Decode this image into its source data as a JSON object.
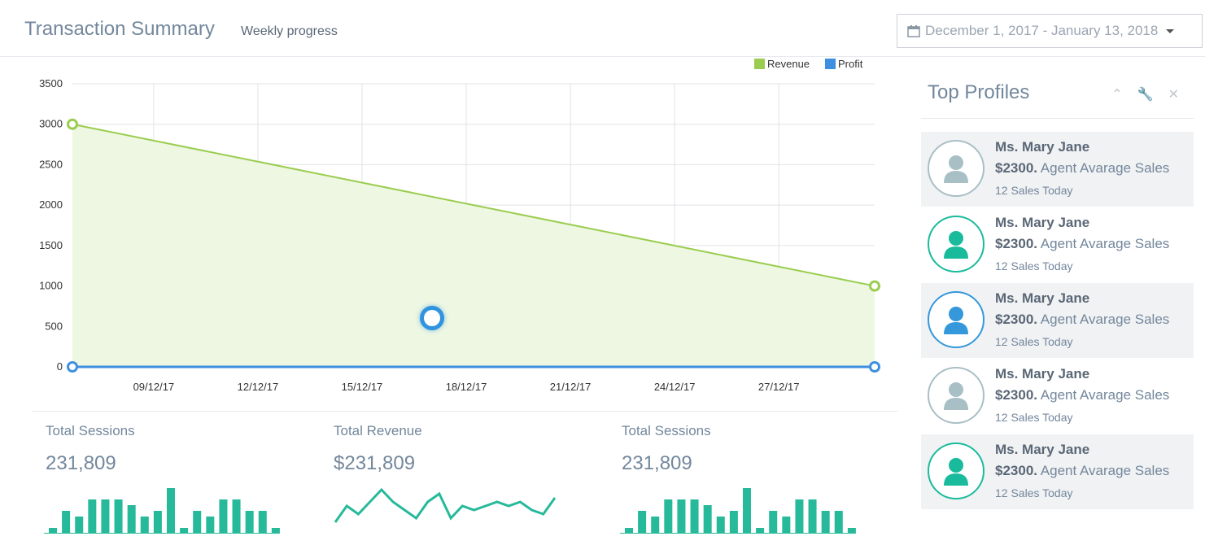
{
  "header": {
    "title": "Transaction Summary",
    "subtitle": "Weekly progress",
    "date_range": "December 1, 2017 - January 13, 2018"
  },
  "chart_data": {
    "type": "area",
    "x": [
      "09/12/17",
      "12/12/17",
      "15/12/17",
      "18/12/17",
      "21/12/17",
      "24/12/17",
      "27/12/17"
    ],
    "ylim": [
      0,
      3500
    ],
    "yticks": [
      0,
      500,
      1000,
      1500,
      2000,
      2500,
      3000,
      3500
    ],
    "grid": true,
    "legend_position": "top-right",
    "series": [
      {
        "name": "Revenue",
        "start": 3000,
        "end": 1000,
        "color": "#9acd4f"
      },
      {
        "name": "Profit",
        "start": 0,
        "end": 0,
        "color": "#3e8fe0"
      }
    ]
  },
  "stats": [
    {
      "label": "Total Sessions",
      "value": "231,809",
      "kind": "bars",
      "data": [
        1,
        4,
        3,
        6,
        6,
        6,
        5,
        3,
        4,
        8,
        1,
        4,
        3,
        6,
        6,
        4,
        4,
        1
      ]
    },
    {
      "label": "Total Revenue",
      "value": "$231,809",
      "kind": "line",
      "data": [
        2,
        6,
        4,
        7,
        10,
        7,
        5,
        3,
        7,
        9,
        3,
        6,
        5,
        6,
        7,
        6,
        7,
        5,
        4,
        8
      ]
    },
    {
      "label": "Total Sessions",
      "value": "231,809",
      "kind": "bars",
      "data": [
        1,
        4,
        3,
        6,
        6,
        6,
        5,
        3,
        4,
        8,
        1,
        4,
        3,
        6,
        6,
        4,
        4,
        1
      ]
    }
  ],
  "profiles": {
    "title": "Top Profiles",
    "items": [
      {
        "name": "Ms. Mary Jane",
        "amount": "$2300.",
        "sales_label": "Agent Avarage Sales",
        "today": "12 Sales Today",
        "color": "#a9bfc6"
      },
      {
        "name": "Ms. Mary Jane",
        "amount": "$2300.",
        "sales_label": "Agent Avarage Sales",
        "today": "12 Sales Today",
        "color": "#1abb9c"
      },
      {
        "name": "Ms. Mary Jane",
        "amount": "$2300.",
        "sales_label": "Agent Avarage Sales",
        "today": "12 Sales Today",
        "color": "#3498db"
      },
      {
        "name": "Ms. Mary Jane",
        "amount": "$2300.",
        "sales_label": "Agent Avarage Sales",
        "today": "12 Sales Today",
        "color": "#a9bfc6"
      },
      {
        "name": "Ms. Mary Jane",
        "amount": "$2300.",
        "sales_label": "Agent Avarage Sales",
        "today": "12 Sales Today",
        "color": "#1abb9c"
      }
    ]
  },
  "colors": {
    "accent": "#26b99a",
    "grid": "#e0e3e6"
  }
}
